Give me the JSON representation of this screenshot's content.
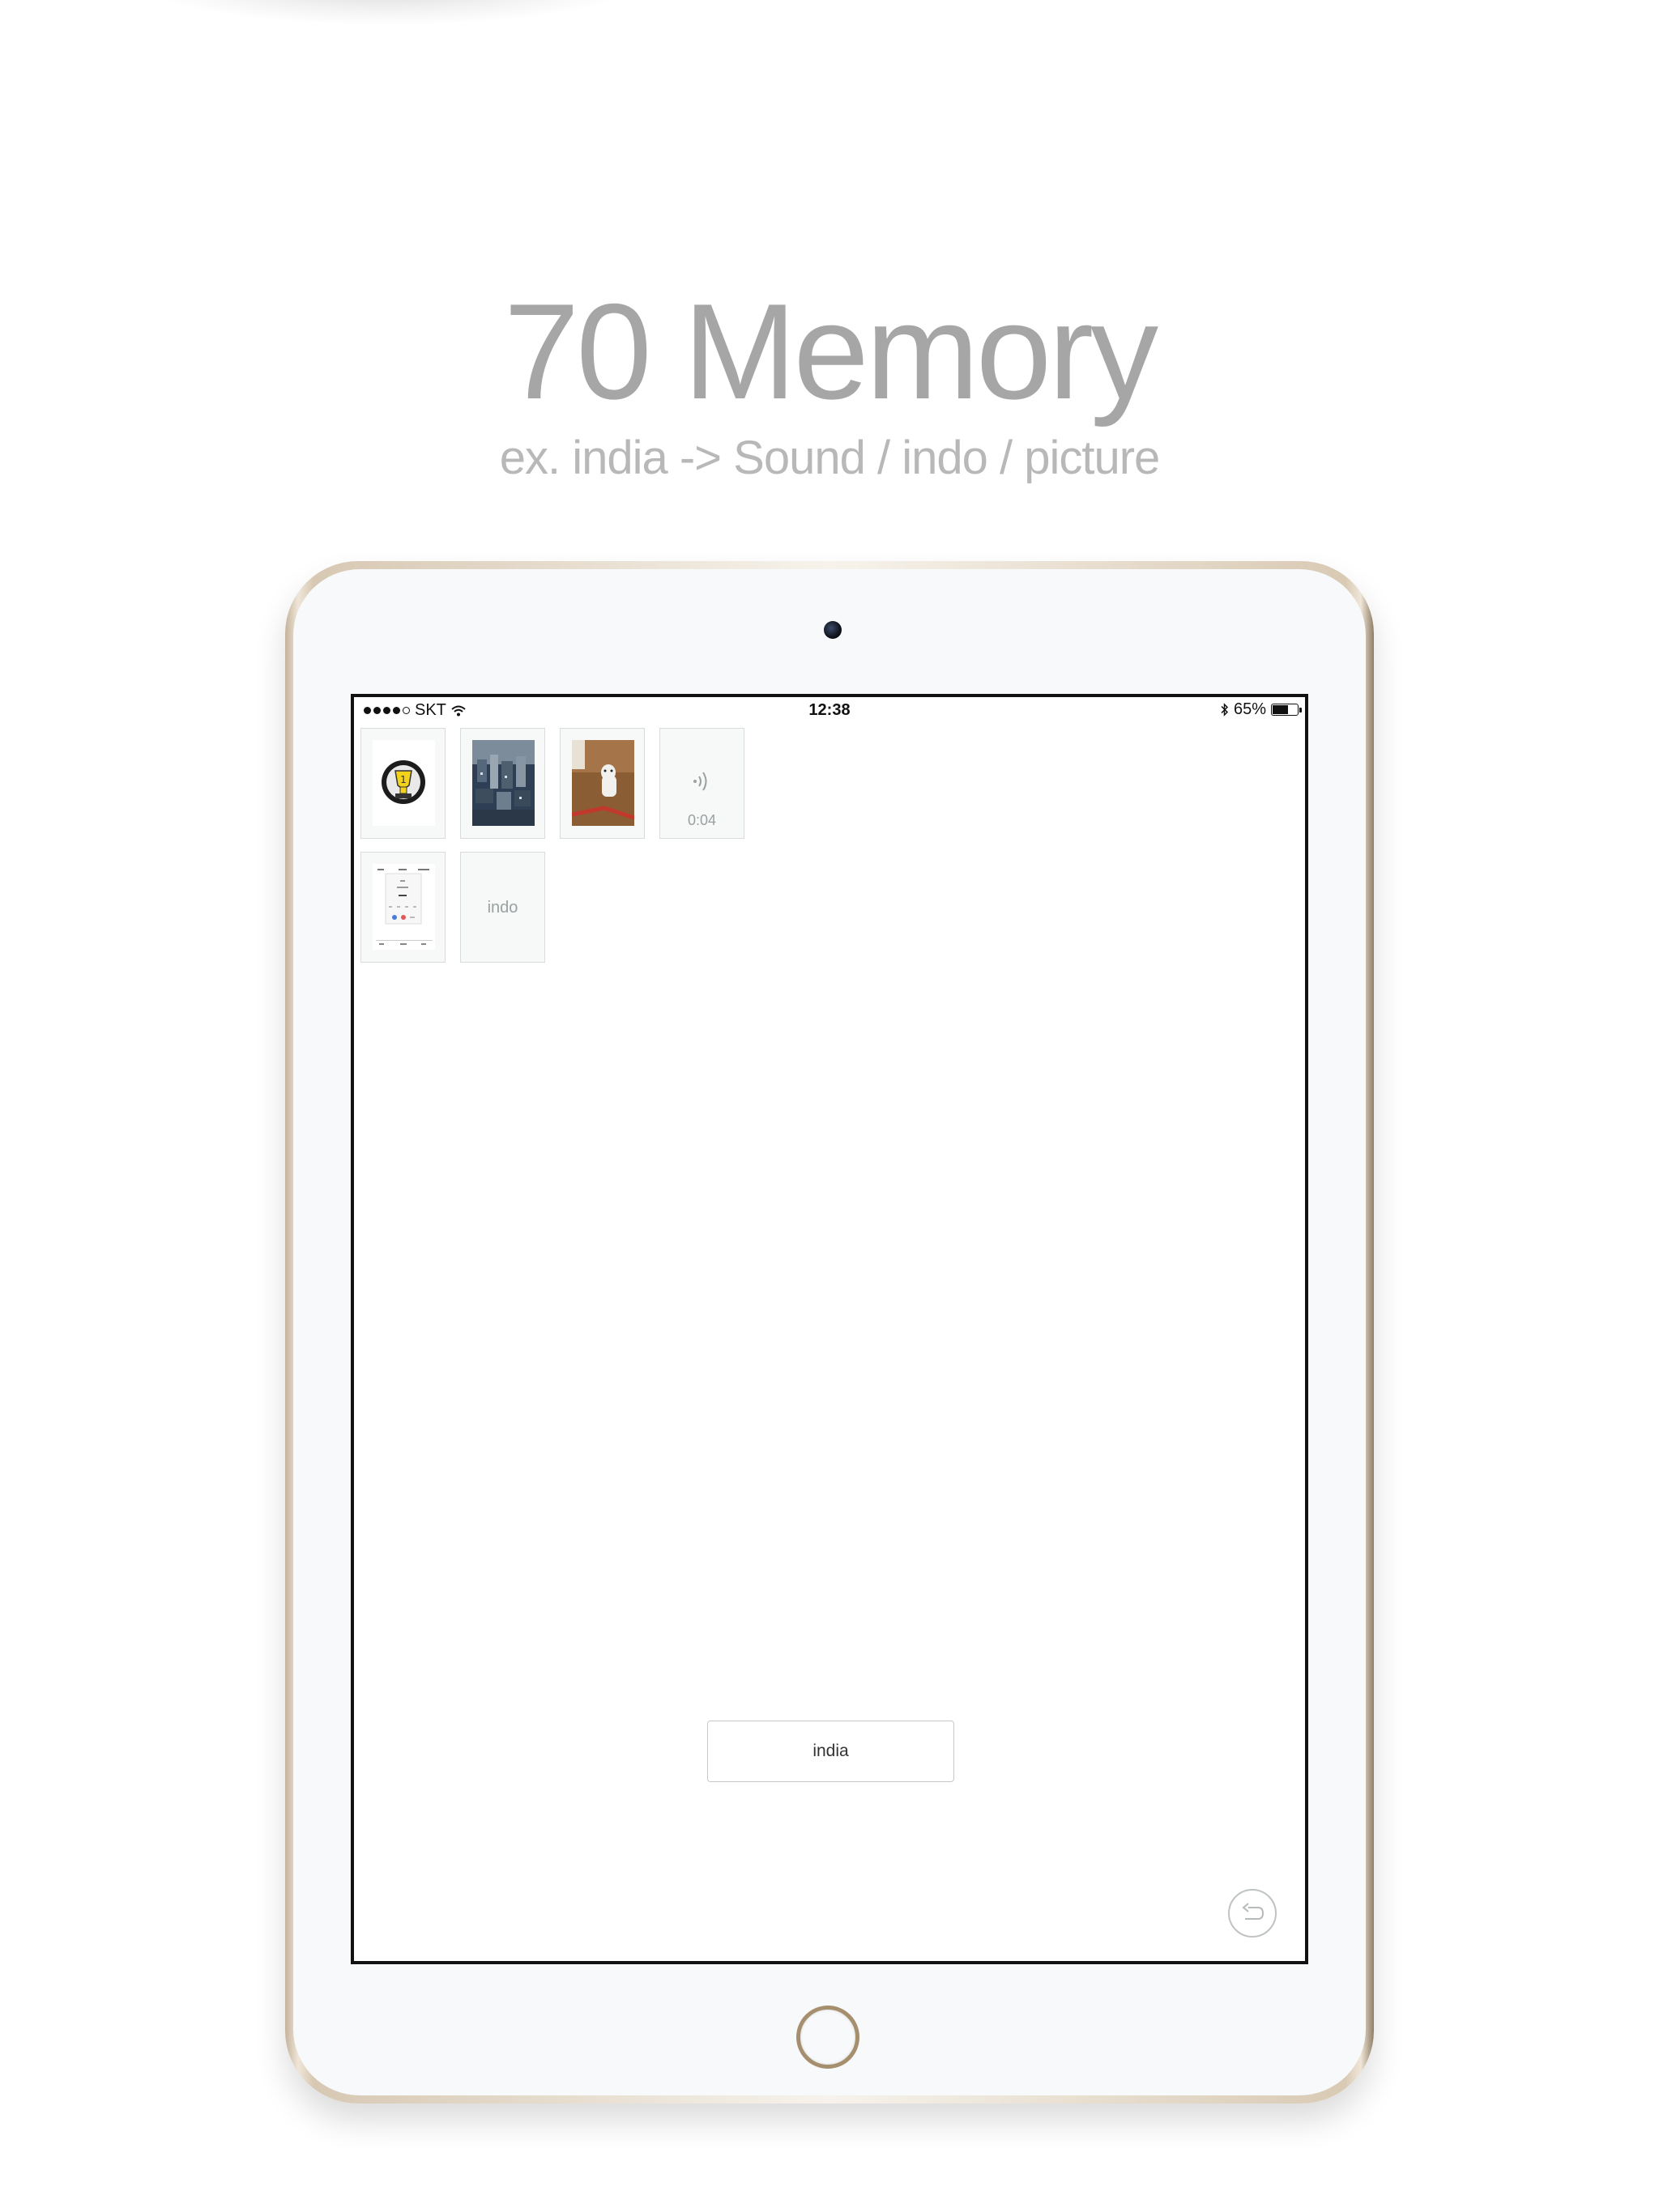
{
  "promo": {
    "headline": "70 Memory",
    "subline": "ex. india -> Sound / indo / picture"
  },
  "status_bar": {
    "carrier": "SKT",
    "signal_bars": 4,
    "time": "12:38",
    "battery_text": "65%",
    "battery_level": 0.65
  },
  "tiles": [
    {
      "type": "image",
      "icon": "trophy-image"
    },
    {
      "type": "image",
      "icon": "city-aerial-photo"
    },
    {
      "type": "image",
      "icon": "dog-photo"
    },
    {
      "type": "sound",
      "icon": "sound-icon",
      "duration": "0:04"
    },
    {
      "type": "image",
      "icon": "screenshot-image"
    },
    {
      "type": "text",
      "word": "indo"
    }
  ],
  "answer": {
    "label": "india"
  },
  "colors": {
    "gold_frame": "#d7c8b3",
    "tile_border": "#d8dcdc",
    "muted_text": "#9aa1a1"
  }
}
